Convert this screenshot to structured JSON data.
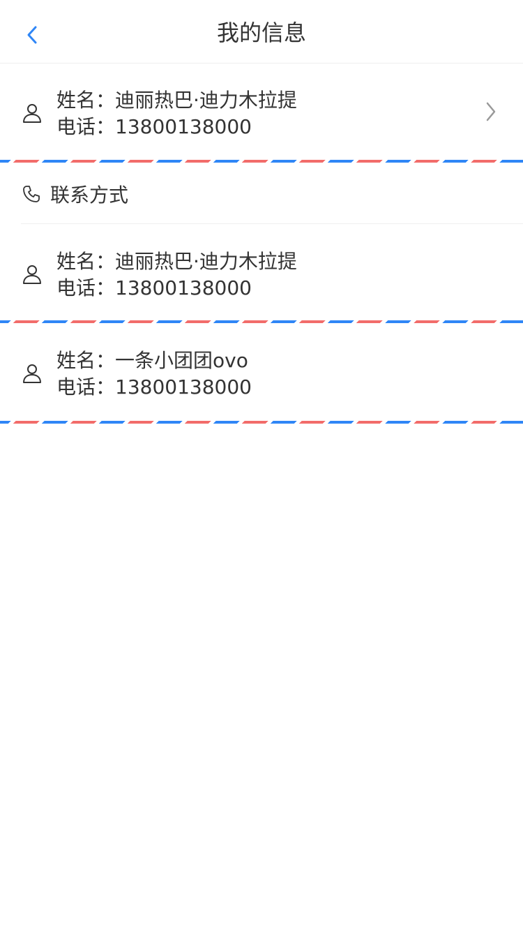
{
  "header": {
    "title": "我的信息"
  },
  "selected_contact": {
    "name_line": "姓名：迪丽热巴·迪力木拉提",
    "phone_line": "电话：13800138000"
  },
  "contacts_section": {
    "label": "联系方式",
    "items": [
      {
        "name_line": "姓名：迪丽热巴·迪力木拉提",
        "phone_line": "电话：13800138000"
      },
      {
        "name_line": "姓名：一条小团团ovo",
        "phone_line": "电话：13800138000"
      }
    ]
  },
  "colors": {
    "accent": "#2f86f6",
    "stripe_red": "#f26c6a",
    "text": "#333333",
    "divider": "#efefef",
    "arrow": "#999999"
  },
  "icons": {
    "back": "chevron-left-icon",
    "person": "person-icon",
    "phone": "phone-icon",
    "arrow": "chevron-right-icon"
  }
}
